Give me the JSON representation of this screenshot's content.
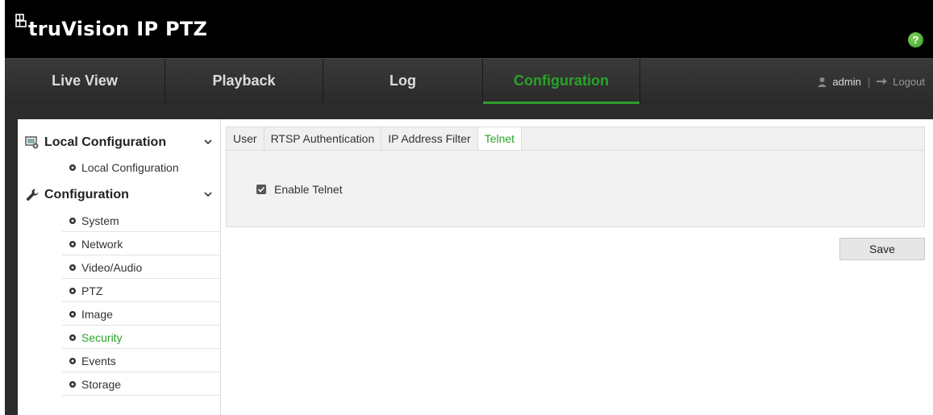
{
  "app": {
    "brand": "truVision IP PTZ",
    "help_label": "?"
  },
  "nav": {
    "tabs": [
      {
        "label": "Live View"
      },
      {
        "label": "Playback"
      },
      {
        "label": "Log"
      },
      {
        "label": "Configuration"
      }
    ],
    "active_tab": "Configuration",
    "user": "admin",
    "separator": "|",
    "logout": "Logout"
  },
  "sidebar": {
    "groups": [
      {
        "label": "Local Configuration",
        "icon": "local-config-icon",
        "items": [
          {
            "label": "Local Configuration"
          }
        ]
      },
      {
        "label": "Configuration",
        "icon": "wrench-icon",
        "items": [
          {
            "label": "System"
          },
          {
            "label": "Network"
          },
          {
            "label": "Video/Audio"
          },
          {
            "label": "PTZ"
          },
          {
            "label": "Image"
          },
          {
            "label": "Security"
          },
          {
            "label": "Events"
          },
          {
            "label": "Storage"
          }
        ]
      }
    ],
    "active_item": "Security"
  },
  "main": {
    "tabs": [
      {
        "label": "User"
      },
      {
        "label": "RTSP Authentication"
      },
      {
        "label": "IP Address Filter"
      },
      {
        "label": "Telnet"
      }
    ],
    "active_tab": "Telnet",
    "enable_telnet": {
      "label": "Enable Telnet",
      "checked": true
    },
    "save_label": "Save"
  },
  "colors": {
    "accent": "#29a329",
    "topbar": "#000000",
    "navbar": "#333333",
    "frame": "#2b2b2b"
  }
}
